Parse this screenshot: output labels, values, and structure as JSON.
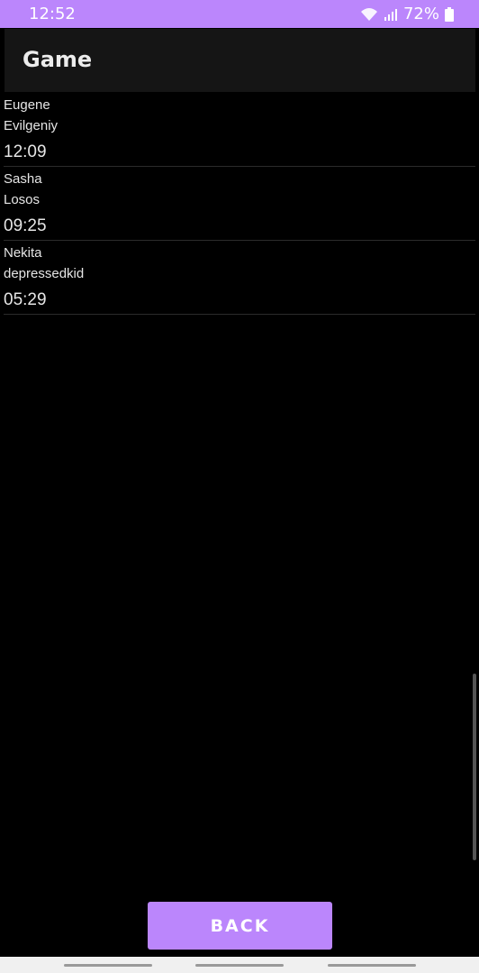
{
  "status_bar": {
    "time": "12:52",
    "battery": "72%"
  },
  "app_bar": {
    "title": "Game"
  },
  "list": {
    "items": [
      {
        "name1": "Eugene",
        "name2": "Evilgeniy",
        "time": "12:09"
      },
      {
        "name1": "Sasha",
        "name2": "Losos",
        "time": "09:25"
      },
      {
        "name1": "Nekita",
        "name2": "depressedkid",
        "time": "05:29"
      }
    ]
  },
  "back_button": {
    "label": "BACK"
  },
  "colors": {
    "accent": "#bb86fc",
    "background": "#000000",
    "app_bar": "#151515"
  }
}
